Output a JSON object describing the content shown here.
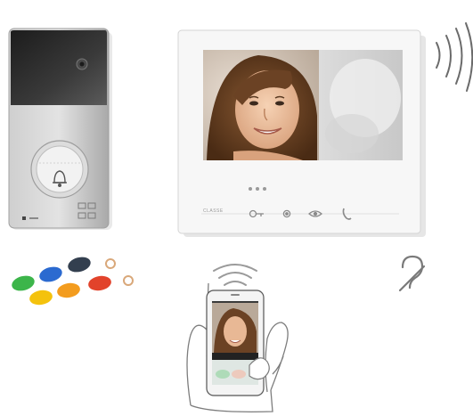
{
  "scene": {
    "description_items": [
      "door-entry-panel",
      "video-monitor",
      "key-fobs",
      "smartphone-app",
      "hearing-aid-symbol"
    ]
  },
  "monitor": {
    "brand": "CLASSE",
    "dots": 3
  },
  "colors": {
    "panel_silver": "#bdbdbd",
    "panel_dark": "#2e2e2e",
    "monitor_frame": "#f5f5f5",
    "wifi_arcs": "#9a9a9a",
    "signal_arcs": "#6b6b6b",
    "fob_green": "#3cb54a",
    "fob_yellow": "#f4c20d",
    "fob_orange": "#f39c1e",
    "fob_red": "#e2432b",
    "fob_blue": "#2b6ad0",
    "fob_dark": "#333f4f"
  }
}
